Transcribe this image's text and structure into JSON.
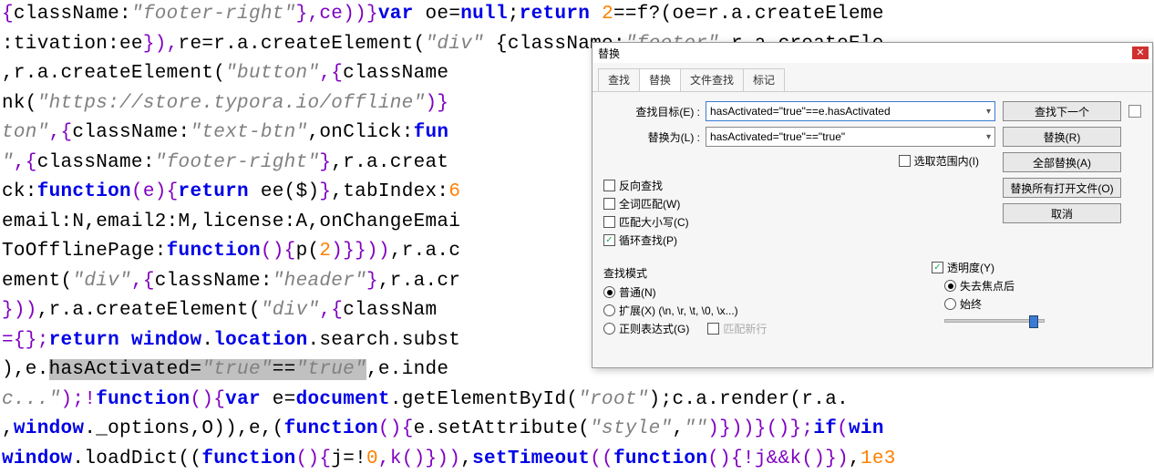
{
  "code": {
    "l1": [
      {
        "t": "{",
        "c": "paren"
      },
      {
        "t": "className:",
        "c": "prop"
      },
      {
        "t": "\"footer-right\"",
        "c": "str"
      },
      {
        "t": "}",
        "c": "paren"
      },
      {
        "t": ",ce))}",
        "c": "paren"
      },
      {
        "t": "var ",
        "c": "kw"
      },
      {
        "t": "oe",
        "c": "id"
      },
      {
        "t": "=",
        "c": "eq"
      },
      {
        "t": "null",
        "c": "kw"
      },
      {
        "t": ";",
        "c": "op"
      },
      {
        "t": "return ",
        "c": "kw"
      },
      {
        "t": "2",
        "c": "num"
      },
      {
        "t": "==",
        "c": "eq"
      },
      {
        "t": "f?(oe=r.a.createEleme",
        "c": "id"
      }
    ],
    "l2": [
      {
        "t": ":tivation:ee",
        "c": "id"
      },
      {
        "t": "}),",
        "c": "paren"
      },
      {
        "t": "re=r.a.createElement(",
        "c": "id"
      },
      {
        "t": "\"div\"",
        "c": "str"
      },
      {
        "t": "  {className:",
        "c": "prop"
      },
      {
        "t": "\"footer\"",
        "c": "str"
      },
      {
        "t": " r a createEle",
        "c": "id"
      }
    ],
    "l3": [
      {
        "t": ",r.a.createElement(",
        "c": "id"
      },
      {
        "t": "\"button\"",
        "c": "str"
      },
      {
        "t": ",{",
        "c": "paren"
      },
      {
        "t": "className",
        "c": "prop"
      }
    ],
    "l4": [
      {
        "t": "nk(",
        "c": "id"
      },
      {
        "t": "\"https://store.typora.io/offline\"",
        "c": "str"
      },
      {
        "t": ")}",
        "c": "paren"
      }
    ],
    "l5": [
      {
        "t": "ton\"",
        "c": "str"
      },
      {
        "t": ",{",
        "c": "paren"
      },
      {
        "t": "className:",
        "c": "prop"
      },
      {
        "t": "\"text-btn\"",
        "c": "str"
      },
      {
        "t": ",onClick:",
        "c": "prop"
      },
      {
        "t": "fun",
        "c": "kw"
      }
    ],
    "l6": [
      {
        "t": "\"",
        "c": "str"
      },
      {
        "t": ",{",
        "c": "paren"
      },
      {
        "t": "className:",
        "c": "prop"
      },
      {
        "t": "\"footer-right\"",
        "c": "str"
      },
      {
        "t": "}",
        "c": "paren"
      },
      {
        "t": ",r.a.creat",
        "c": "id"
      }
    ],
    "l7": [
      {
        "t": "ck:",
        "c": "prop"
      },
      {
        "t": "function",
        "c": "kw"
      },
      {
        "t": "(e){",
        "c": "paren"
      },
      {
        "t": "return ",
        "c": "kw"
      },
      {
        "t": "ee($)",
        "c": "id"
      },
      {
        "t": "}",
        "c": "paren"
      },
      {
        "t": ",tabIndex:",
        "c": "prop"
      },
      {
        "t": "6",
        "c": "num"
      }
    ],
    "l8": [
      {
        "t": "email:N,email2:M,license:A,onChangeEmai",
        "c": "id"
      }
    ],
    "l9": [
      {
        "t": "ToOfflinePage:",
        "c": "prop"
      },
      {
        "t": "function",
        "c": "kw"
      },
      {
        "t": "(){",
        "c": "paren"
      },
      {
        "t": "p(",
        "c": "id"
      },
      {
        "t": "2",
        "c": "num"
      },
      {
        "t": ")}}))",
        "c": "paren"
      },
      {
        "t": ",r.a.c",
        "c": "id"
      }
    ],
    "l10": [
      {
        "t": "ement(",
        "c": "id"
      },
      {
        "t": "\"div\"",
        "c": "str"
      },
      {
        "t": ",{",
        "c": "paren"
      },
      {
        "t": "className:",
        "c": "prop"
      },
      {
        "t": "\"header\"",
        "c": "str"
      },
      {
        "t": "}",
        "c": "paren"
      },
      {
        "t": ",r.a.cr",
        "c": "id"
      }
    ],
    "l11": [
      {
        "t": "}))",
        "c": "paren"
      },
      {
        "t": ",r.a.createElement(",
        "c": "id"
      },
      {
        "t": "\"div\"",
        "c": "str"
      },
      {
        "t": ",{",
        "c": "paren"
      },
      {
        "t": "classNam",
        "c": "prop"
      }
    ],
    "l12": [
      {
        "t": "={};",
        "c": "paren"
      },
      {
        "t": "return ",
        "c": "kw"
      },
      {
        "t": "window",
        "c": "kw"
      },
      {
        "t": ".",
        "c": "dot"
      },
      {
        "t": "location",
        "c": "kw"
      },
      {
        "t": ".search.subst",
        "c": "id"
      }
    ],
    "l13a": [
      {
        "t": "),e.",
        "c": "id"
      }
    ],
    "l13b": [
      {
        "t": "hasActivated=",
        "c": "id"
      },
      {
        "t": "\"true\"",
        "c": "str"
      },
      {
        "t": "==",
        "c": "eq"
      },
      {
        "t": "\"true\"",
        "c": "str"
      }
    ],
    "l13c": [
      {
        "t": ",e.inde",
        "c": "id"
      }
    ],
    "l14": [
      {
        "t": "c...\"",
        "c": "str"
      },
      {
        "t": ");!",
        "c": "paren"
      },
      {
        "t": "function",
        "c": "kw"
      },
      {
        "t": "(){",
        "c": "paren"
      },
      {
        "t": "var ",
        "c": "kw"
      },
      {
        "t": "e=",
        "c": "id"
      },
      {
        "t": "document",
        "c": "kw"
      },
      {
        "t": ".getElementById(",
        "c": "id"
      },
      {
        "t": "\"root\"",
        "c": "str"
      },
      {
        "t": ");c.a.render(r.a.",
        "c": "id"
      }
    ],
    "l15": [
      {
        "t": ",",
        "c": "op"
      },
      {
        "t": "window",
        "c": "kw"
      },
      {
        "t": "._options,O)),e,(",
        "c": "id"
      },
      {
        "t": "function",
        "c": "kw"
      },
      {
        "t": "(){",
        "c": "paren"
      },
      {
        "t": "e.setAttribute(",
        "c": "id"
      },
      {
        "t": "\"style\"",
        "c": "str"
      },
      {
        "t": ",",
        "c": "op"
      },
      {
        "t": "\"\"",
        "c": "str"
      },
      {
        "t": ")}))}()};",
        "c": "paren"
      },
      {
        "t": "if",
        "c": "kw"
      },
      {
        "t": "(",
        "c": "paren"
      },
      {
        "t": "win",
        "c": "kw"
      }
    ],
    "l16": [
      {
        "t": "window",
        "c": "kw"
      },
      {
        "t": ".loadDict((",
        "c": "id"
      },
      {
        "t": "function",
        "c": "kw"
      },
      {
        "t": "(){",
        "c": "paren"
      },
      {
        "t": "j=!",
        "c": "id"
      },
      {
        "t": "0",
        "c": "num"
      },
      {
        "t": ",k()}))",
        "c": "paren"
      },
      {
        "t": ",",
        "c": "op"
      },
      {
        "t": "setTimeout",
        "c": "kw"
      },
      {
        "t": "((",
        "c": "paren"
      },
      {
        "t": "function",
        "c": "kw"
      },
      {
        "t": "(){!j&&k()})",
        "c": "paren"
      },
      {
        "t": ",",
        "c": "op"
      },
      {
        "t": "1e3",
        "c": "num"
      }
    ]
  },
  "dialog": {
    "title": "替换",
    "tabs": {
      "find": "查找",
      "replace": "替换",
      "find_in_files": "文件查找",
      "mark": "标记"
    },
    "labels": {
      "find_target": "查找目标(E) :",
      "replace_with": "替换为(L) :"
    },
    "inputs": {
      "find_value": "hasActivated=\"true\"==e.hasActivated",
      "replace_value": "hasActivated=\"true\"==\"true\""
    },
    "buttons": {
      "find_next": "查找下一个",
      "replace": "替换(R)",
      "replace_all": "全部替换(A)",
      "replace_all_open": "替换所有打开文件(O)",
      "cancel": "取消"
    },
    "options": {
      "in_selection": "选取范围内(I)",
      "backward": "反向查找",
      "whole_word": "全词匹配(W)",
      "match_case": "匹配大小写(C)",
      "wrap": "循环查找(P)"
    },
    "search_mode": {
      "title": "查找模式",
      "normal": "普通(N)",
      "extended": "扩展(X) (\\n, \\r, \\t, \\0, \\x...)",
      "regex": "正则表达式(G)",
      "hint": "匹配新行"
    },
    "transparency": {
      "title": "透明度(Y)",
      "on_lose_focus": "失去焦点后",
      "always": "始终"
    }
  }
}
